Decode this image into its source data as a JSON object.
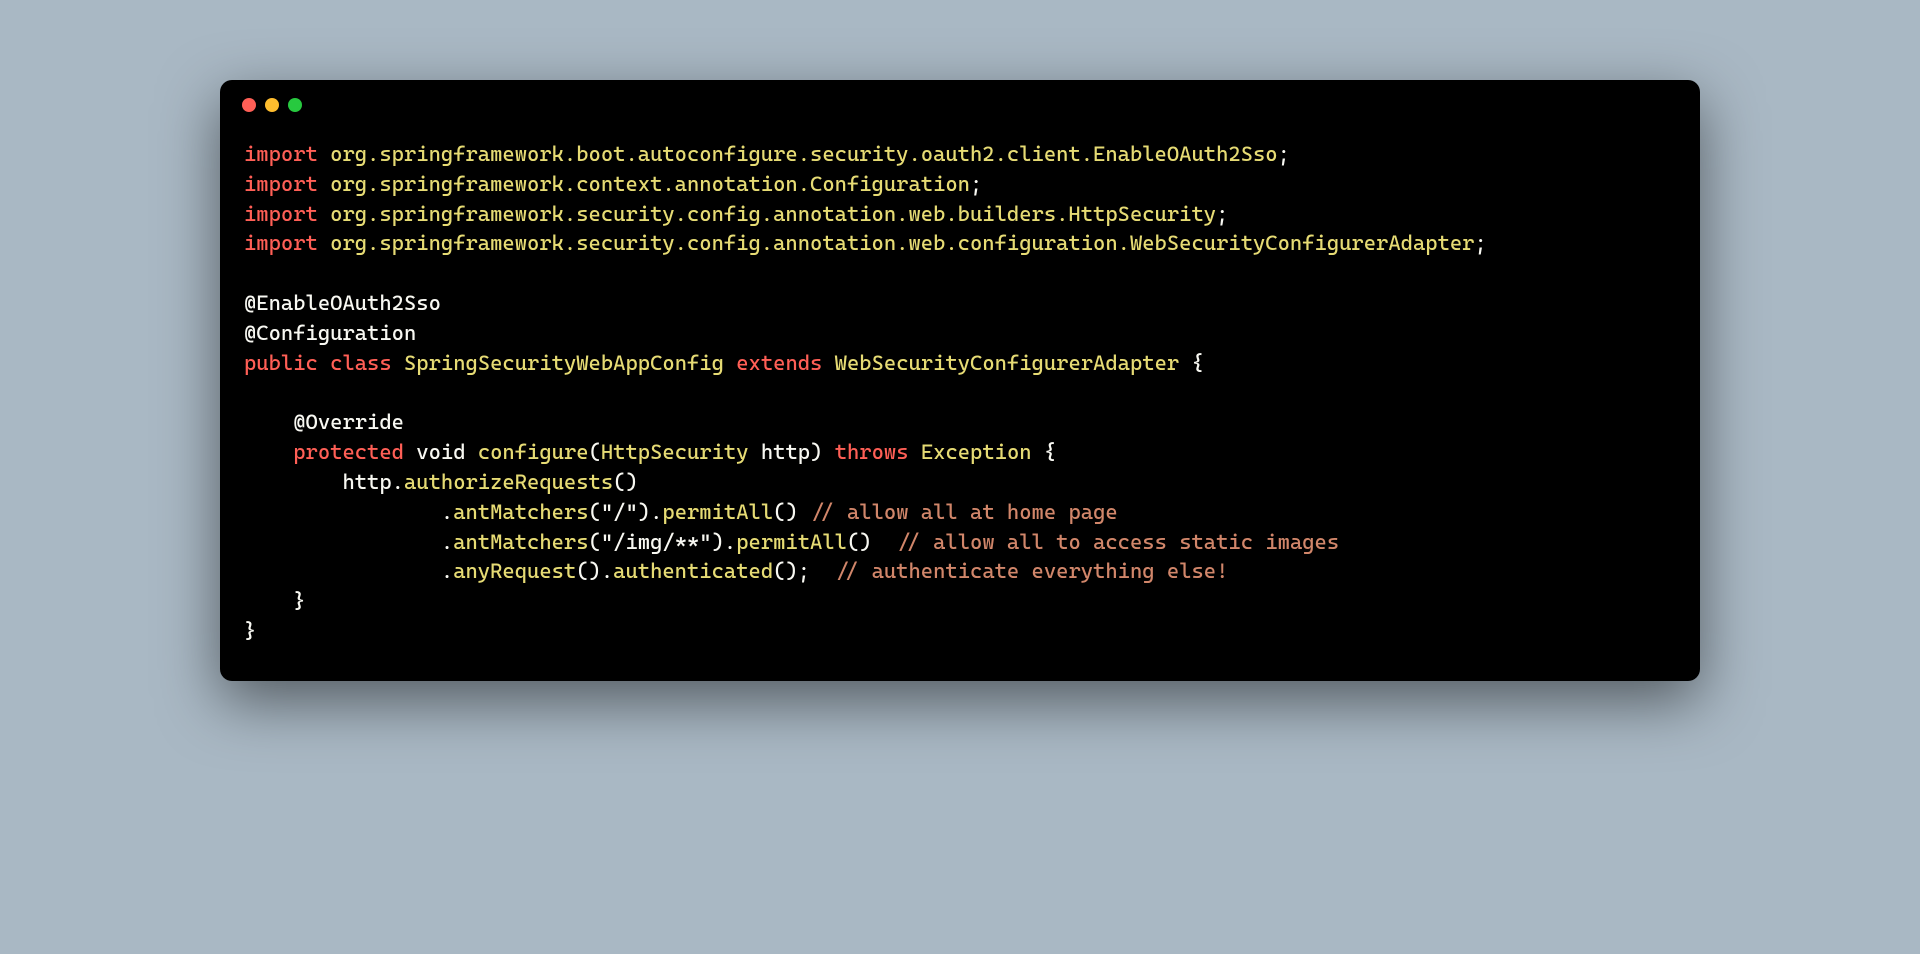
{
  "code": {
    "import_kw": "import",
    "pkg1": "org.springframework.boot.autoconfigure.security.oauth2.client.EnableOAuth2Sso",
    "pkg2": "org.springframework.context.annotation.Configuration",
    "pkg3": "org.springframework.security.config.annotation.web.builders.HttpSecurity",
    "pkg4": "org.springframework.security.config.annotation.web.configuration.WebSecurityConfigurerAdapter",
    "semicolon": ";",
    "blank": "",
    "annot1": "@EnableOAuth2Sso",
    "annot2": "@Configuration",
    "public_kw": "public",
    "class_kw": "class",
    "class_name": "SpringSecurityWebAppConfig",
    "extends_kw": "extends",
    "super_class": "WebSecurityConfigurerAdapter",
    "brace_open": " {",
    "brace_close": "}",
    "annot3": "    @Override",
    "protected_kw": "    protected",
    "void_kw": "void",
    "method_name": "configure",
    "paren_open": "(",
    "param_type": "HttpSecurity",
    "param_name": " http",
    "paren_close": ")",
    "throws_kw": "throws",
    "exception_type": "Exception",
    "body_l1": "        http.",
    "body_l1b": "authorizeRequests",
    "body_l1c": "()",
    "body_l2a": "                .",
    "body_l2m1": "antMatchers",
    "body_l2p": "(",
    "body_l2s": "\"/\"",
    "body_l2pc": ").",
    "body_l2m2": "permitAll",
    "body_l2e": "()",
    "body_l2c": " // allow all at home page",
    "body_l3a": "                .",
    "body_l3m1": "antMatchers",
    "body_l3p": "(",
    "body_l3s": "\"/img/**\"",
    "body_l3pc": ").",
    "body_l3m2": "permitAll",
    "body_l3e": "()",
    "body_l3c": "  // allow all to access static images",
    "body_l4a": "                .",
    "body_l4m1": "anyRequest",
    "body_l4p": "().",
    "body_l4m2": "authenticated",
    "body_l4e": "();",
    "body_l4c": "  // authenticate everything else!",
    "close_method": "    }"
  }
}
